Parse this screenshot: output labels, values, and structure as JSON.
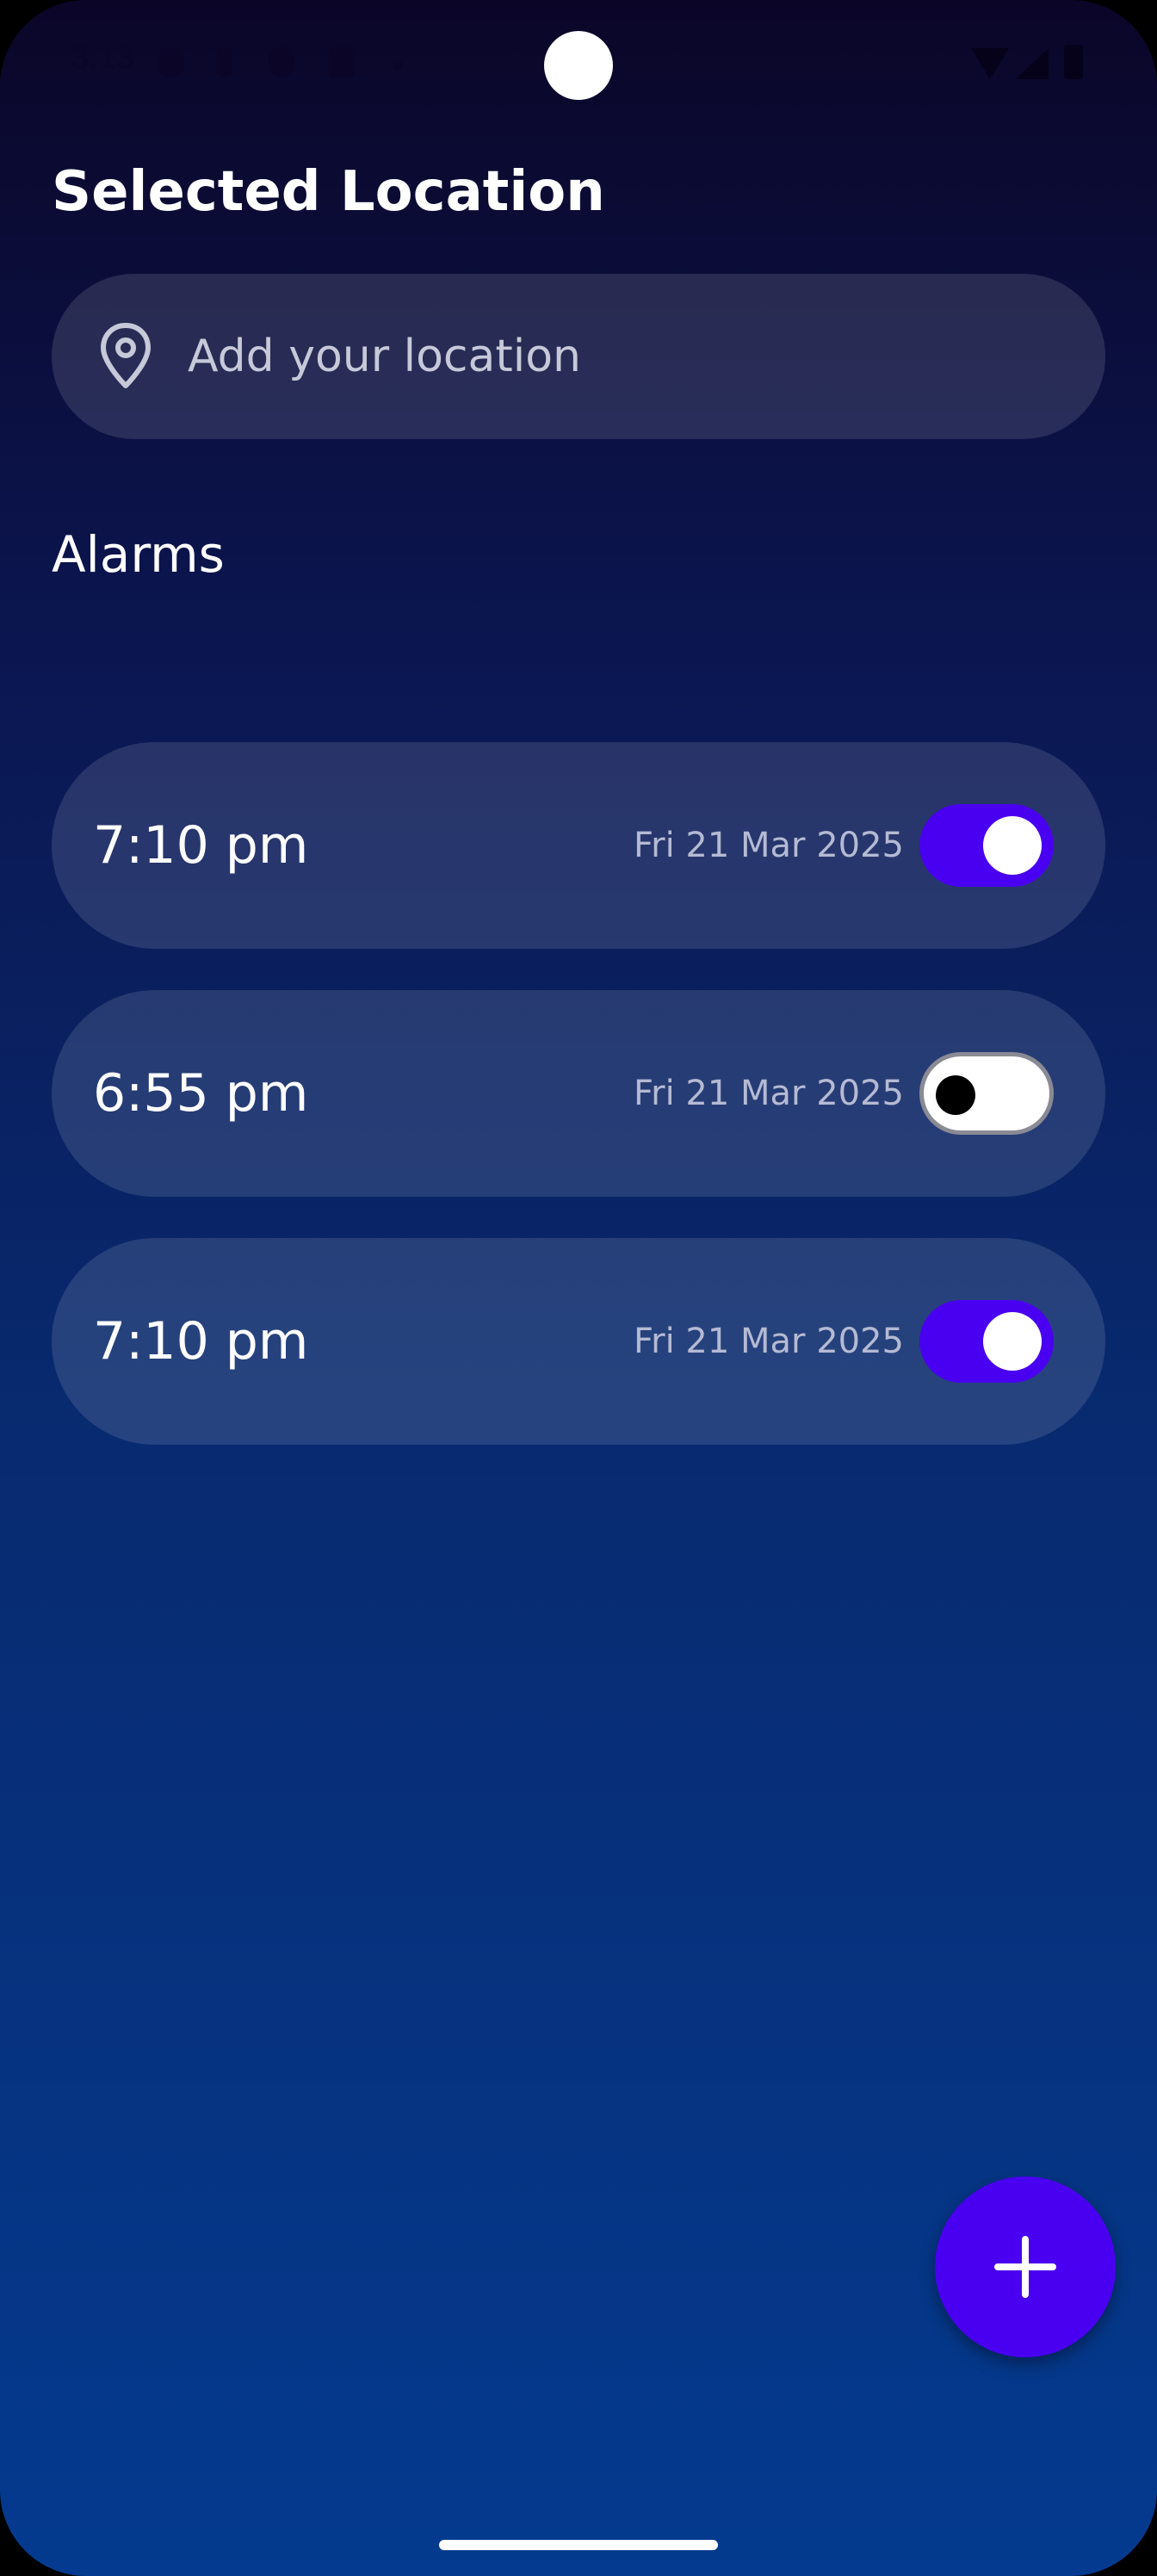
{
  "status_bar": {
    "time": "3:13"
  },
  "header": {
    "title": "Selected Location"
  },
  "location": {
    "placeholder": "Add your location",
    "icon": "map-pin-icon"
  },
  "alarms_section": {
    "title": "Alarms",
    "items": [
      {
        "time": "7:10 pm",
        "date": "Fri 21 Mar 2025",
        "enabled": true
      },
      {
        "time": "6:55 pm",
        "date": "Fri 21 Mar 2025",
        "enabled": false
      },
      {
        "time": "7:10 pm",
        "date": "Fri 21 Mar 2025",
        "enabled": true
      }
    ]
  },
  "fab": {
    "icon": "plus-icon"
  },
  "colors": {
    "accent": "#4a00f0",
    "background_top": "#0b0628",
    "background_bottom": "#043a8f",
    "card": "rgba(255,255,255,0.12)"
  }
}
